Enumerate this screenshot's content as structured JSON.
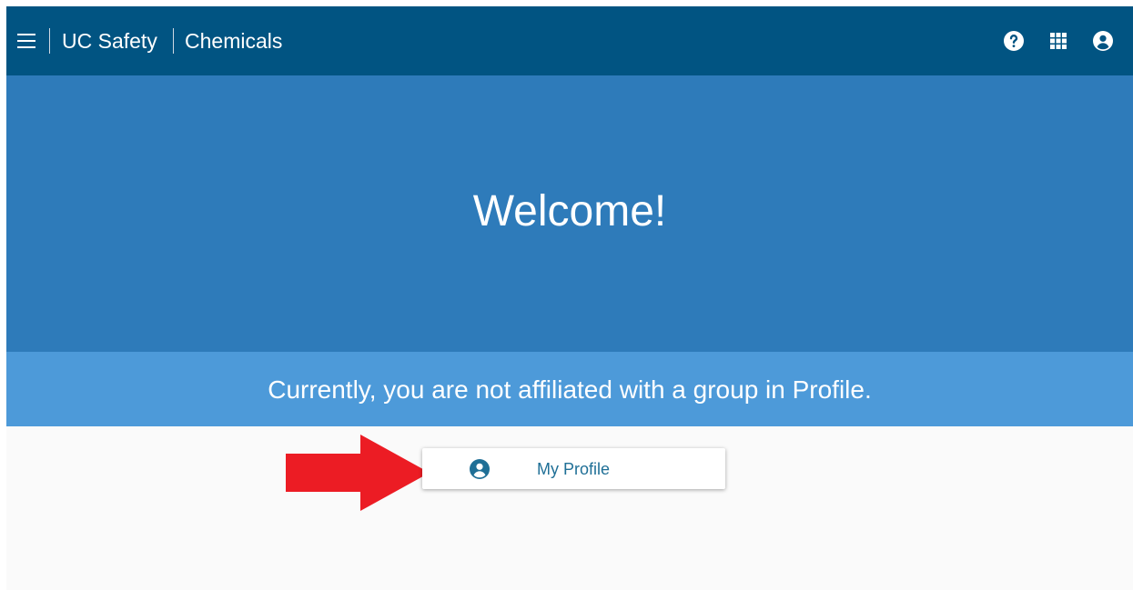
{
  "header": {
    "app_name": "UC Safety",
    "module_name": "Chemicals",
    "icons": [
      "menu-icon",
      "help-icon",
      "apps-grid-icon",
      "account-icon"
    ]
  },
  "hero": {
    "title": "Welcome!"
  },
  "notice": {
    "text": "Currently, you are not affiliated with a group in Profile."
  },
  "profile_button": {
    "label": "My Profile",
    "icon": "account-circle-icon"
  },
  "annotation": {
    "icon": "red-arrow-icon"
  },
  "colors": {
    "header_bg": "#015482",
    "hero_bg": "#2e7bba",
    "notice_bg": "#4d9ad9",
    "page_bg": "#fafafa",
    "button_text": "#1f6f96",
    "arrow": "#ec1c24"
  }
}
